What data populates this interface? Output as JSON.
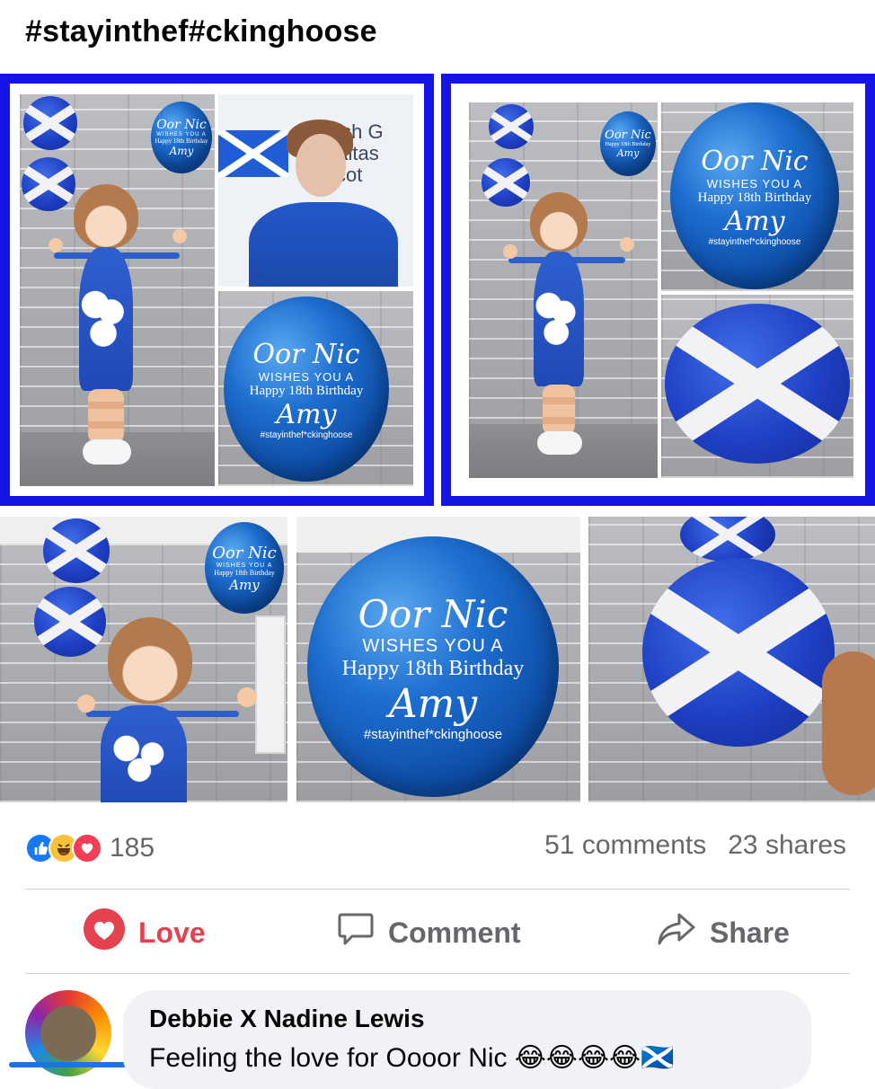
{
  "post": {
    "text": "#stayinthef#ckinghoose"
  },
  "balloon_text": {
    "line1": "Oor Nic",
    "line2": "WISHES YOU A",
    "line3": "Happy 18th Birthday",
    "line4": "Amy",
    "line5": "#stayinthef*ckinghoose"
  },
  "sign_text": "ttish G\nhaltas\nscot",
  "photo_border_color": "#1414e6",
  "reactions": {
    "icons": [
      "like-icon",
      "haha-icon",
      "love-icon"
    ],
    "count": "185",
    "comments": "51 comments",
    "shares": "23 shares"
  },
  "actions": {
    "love": "Love",
    "comment": "Comment",
    "share": "Share"
  },
  "comment": {
    "author": "Debbie X Nadine Lewis",
    "text": "Feeling the love for Oooor Nic 😂😂😂😂🏴󠁧󠁢󠁳󠁣󠁴󠁿"
  },
  "colors": {
    "love_red": "#e4424e",
    "muted_text": "#65676b",
    "like_blue": "#1877f2"
  }
}
